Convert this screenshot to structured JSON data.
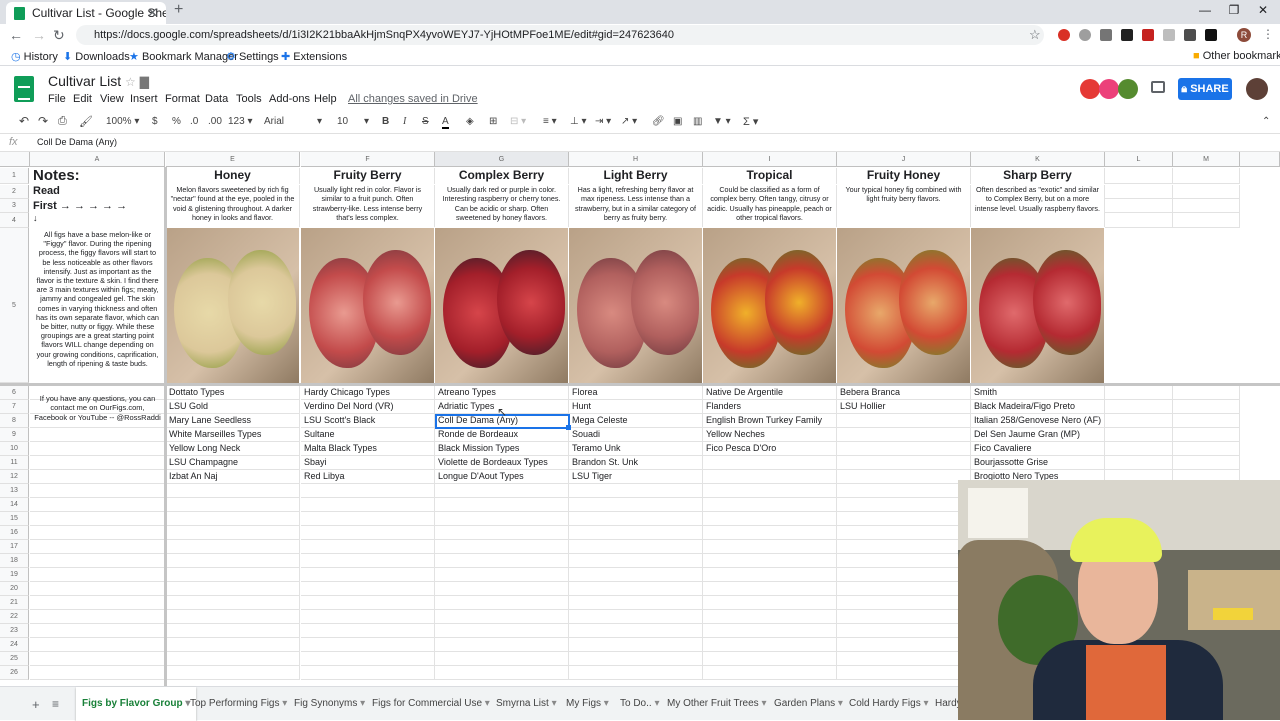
{
  "browser": {
    "tab_title": "Cultivar List - Google Sheets",
    "url": "https://docs.google.com/spreadsheets/d/1i3I2K21bbaAkHjmSnqPX4yvoWEYJ7-YjHOtMPFoe1ME/edit#gid=247623640",
    "profile_letter": "R",
    "bookmarks": [
      "History",
      "Downloads",
      "Bookmark Manager",
      "Settings",
      "Extensions"
    ],
    "other_bookmarks": "Other bookmarks"
  },
  "sheets": {
    "title": "Cultivar List",
    "menus": [
      "File",
      "Edit",
      "View",
      "Insert",
      "Format",
      "Data",
      "Tools",
      "Add-ons",
      "Help"
    ],
    "saved_status": "All changes saved in Drive",
    "share_label": "SHARE"
  },
  "toolbar": {
    "zoom": "100%",
    "currency": "$",
    "percent": "%",
    "dec_less": ".0",
    "dec_more": ".00",
    "more_formats": "123",
    "font": "Arial",
    "font_size": "10",
    "bold": "B",
    "italic": "I",
    "strike": "S",
    "text_color": "A",
    "functions": "Σ"
  },
  "formula_bar": {
    "fx": "fx",
    "value": "Coll De Dama (Any)"
  },
  "grid": {
    "columns": [
      "A",
      "E",
      "F",
      "G",
      "H",
      "I",
      "J",
      "K",
      "L",
      "M"
    ],
    "rows": [
      "1",
      "2",
      "3",
      "4",
      "5",
      "6",
      "7",
      "8",
      "9",
      "10",
      "11",
      "12",
      "13",
      "14",
      "15",
      "16",
      "17",
      "18",
      "19",
      "20",
      "21",
      "22",
      "23",
      "24",
      "25",
      "26"
    ],
    "notes_title": "Notes:",
    "notes_read": "Read",
    "notes_first": "First → → → → →",
    "notes_down": "↓",
    "notes_body": "All figs have a base melon-like or \"Figgy\" flavor. During the ripening process, the figgy flavors will start to be less noticeable as other flavors intensify. Just as important as the flavor is the texture & skin. I find there are 3 main textures within figs; meaty, jammy and congealed gel. The skin comes in varying thickness and often has its own separate flavor, which can be bitter, nutty or figgy. While these groupings are a great starting point flavors WILL change depending on your growing conditions, caprification, length of ripening & taste buds.",
    "contact": "If you have any questions, you can contact me on OurFigs.com, Facebook or YouTube -- @RossRaddi",
    "flavor_groups": [
      {
        "name": "Honey",
        "desc": "Melon flavors sweetened by rich fig \"nectar\" found at the eye, pooled in the void & glistening throughout. A darker honey in looks and flavor.",
        "cultivars": [
          "Dottato Types",
          "LSU Gold",
          "Mary Lane Seedless",
          "White Marseilles Types",
          "Yellow Long Neck",
          "LSU Champagne",
          "Izbat An Naj"
        ]
      },
      {
        "name": "Fruity Berry",
        "desc": "Usually light red in color. Flavor is similar to a fruit punch. Often strawberry-like. Less intense berry that's less complex.",
        "cultivars": [
          "Hardy Chicago Types",
          "Verdino Del Nord (VR)",
          "LSU Scott's Black",
          "Sultane",
          "Malta Black Types",
          "Sbayi",
          "Red Libya"
        ]
      },
      {
        "name": "Complex Berry",
        "desc": "Usually dark red or purple in color. Interesting raspberry or cherry tones. Can be acidic or sharp. Often sweetened by honey flavors.",
        "cultivars": [
          "Atreano Types",
          "Adriatic Types",
          "Coll De Dama (Any)",
          "Ronde de Bordeaux",
          "Black Mission Types",
          "Violette de Bordeaux Types",
          "Longue D'Aout Types"
        ]
      },
      {
        "name": "Light Berry",
        "desc": "Has a light, refreshing berry flavor at max ripeness. Less intense than a strawberry, but in a similar category of berry as fruity berry.",
        "cultivars": [
          "Florea",
          "Hunt",
          "Mega Celeste",
          "Souadi",
          "Teramo Unk",
          "Brandon St. Unk",
          "LSU Tiger"
        ]
      },
      {
        "name": "Tropical",
        "desc": "Could be classified as a form of complex berry. Often tangy, citrusy or acidic. Usually has pineapple, peach or other tropical flavors.",
        "cultivars": [
          "Native De Argentile",
          "Flanders",
          "English Brown Turkey Family",
          "Yellow Neches",
          "Fico Pesca D'Oro",
          "",
          ""
        ]
      },
      {
        "name": "Fruity Honey",
        "desc": "Your typical honey fig combined with light fruity berry flavors.",
        "cultivars": [
          "Bebera Branca",
          "LSU Hollier",
          "",
          "",
          "",
          "",
          ""
        ]
      },
      {
        "name": "Sharp Berry",
        "desc": "Often described as \"exotic\" and similar to Complex Berry, but on a more intense level. Usually raspberry flavors.",
        "cultivars": [
          "Smith",
          "Black Madeira/Figo Preto",
          "Italian 258/Genovese Nero (AF)",
          "Del Sen Jaume Gran (MP)",
          "Fico Cavaliere",
          "Bourjassotte Grise",
          "Brogiotto Nero Types"
        ]
      }
    ]
  },
  "sheet_tabs": [
    "Figs by Flavor Group",
    "Top Performing Figs",
    "Fig Synonyms",
    "Figs for Commercial Use",
    "Smyrna List",
    "My Figs",
    "To Do..",
    "My Other Fruit Trees",
    "Garden Plans",
    "Cold Hardy Figs",
    "Hardy"
  ],
  "colors": {
    "sheets_green": "#0f9d58",
    "share_blue": "#1a73e8",
    "selection_blue": "#1a73e8"
  }
}
